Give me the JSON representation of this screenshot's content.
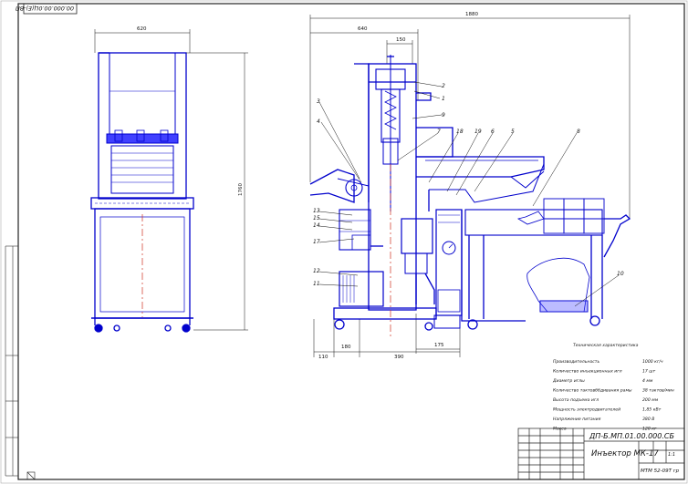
{
  "sheet": {
    "code_stamp_rotated": "00.000.00.0Ц(Е)-ВП",
    "drawing_number": "ДП-Б.МП.01.00.000.СБ",
    "title": "Инъектор МК-17",
    "sheet_format": "1:1",
    "group": "МТМ 52-09Т гр"
  },
  "dimensions": {
    "front_width": "620",
    "front_height": "1760",
    "side_overall": "1880",
    "side_left": "640",
    "side_top": "150",
    "bottom_1": "110",
    "bottom_2": "180",
    "bottom_3": "390",
    "bottom_4": "175"
  },
  "callouts": [
    "1",
    "2",
    "3",
    "4",
    "5",
    "6",
    "7",
    "8",
    "9",
    "10",
    "11",
    "12",
    "13",
    "14",
    "15",
    "16",
    "17",
    "18",
    "19"
  ],
  "specs": {
    "heading": "Техническая характеристика",
    "rows": [
      {
        "label": "Производительность",
        "value": "1000 кг/ч"
      },
      {
        "label": "Количество инъекционных игл",
        "value": "17 шт"
      },
      {
        "label": "Диаметр иглы",
        "value": "4 мм"
      },
      {
        "label": "Количество тактовббдивания рамы",
        "value": "38 тактов/мин"
      },
      {
        "label": "Высота подъема игл",
        "value": "200 мм"
      },
      {
        "label": "Мощность электродвигателей",
        "value": "1,85 кВт"
      },
      {
        "label": "Напряжение питания",
        "value": "380 В"
      },
      {
        "label": "Масса",
        "value": "120 кг"
      }
    ]
  },
  "colors": {
    "outline": "#0000cc",
    "dim": "#111111",
    "fill": "#4040ff"
  }
}
